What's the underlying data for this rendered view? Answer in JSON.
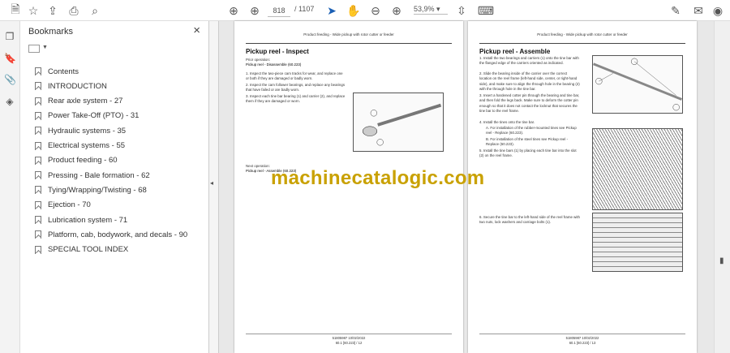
{
  "toolbar": {
    "page_current": "818",
    "page_total": "/ 1107",
    "zoom": "53,9%"
  },
  "sidebar": {
    "title": "Bookmarks",
    "close": "×",
    "items": [
      {
        "label": "Contents"
      },
      {
        "label": "INTRODUCTION"
      },
      {
        "label": "Rear axle system - 27"
      },
      {
        "label": "Power Take-Off (PTO) - 31"
      },
      {
        "label": "Hydraulic systems - 35"
      },
      {
        "label": "Electrical systems - 55"
      },
      {
        "label": "Product feeding - 60"
      },
      {
        "label": "Pressing - Bale formation - 62"
      },
      {
        "label": "Tying/Wrapping/Twisting - 68"
      },
      {
        "label": "Ejection - 70"
      },
      {
        "label": "Lubrication system - 71"
      },
      {
        "label": "Platform, cab, bodywork, and decals - 90"
      },
      {
        "label": "SPECIAL TOOL INDEX"
      }
    ]
  },
  "left_page": {
    "header": "Product feeding - Wide pickup with rotor cutter or feeder",
    "title": "Pickup reel - Inspect",
    "prior_label": "Prior operation:",
    "prior_link": "Pickup reel - Disassemble (60.223)",
    "steps": [
      "1.  Inspect the two-piece cam tracks for wear, and replace one or both if they are damaged or badly worn.",
      "2.  Inspect the cam follower bearings, and replace any bearings that have failed or are badly worn.",
      "3.  Inspect each tine bar bearing (1) and carrier (2), and replace them if they are damaged or worn."
    ],
    "next_label": "Next operation:",
    "next_link": "Pickup reel - Assemble (60.223)",
    "footer_1": "51805987 10/02/2022",
    "footer_2": "60.1 [60.223] / 12"
  },
  "right_page": {
    "header": "Product feeding - Wide pickup with rotor cutter or feeder",
    "title": "Pickup reel - Assemble",
    "steps": [
      "1.  Install the two bearings and carriers (1) onto the tine bar with the flanged edge of the carriers oriented as indicated.",
      "2.  Slide the bearing inside of the carrier over the correct location on the reel frame (left-hand side, center, or right-hand side), and make sure to align the through hole in the bearing (2) with the through hole in the tine bar.",
      "3.  Insert a hardened cotter pin through the bearing and tine bar, and then fold the legs back. Make sure to deform the cotter pin enough so that it does not contact the locknut that secures the tine bar to the reel frame.",
      "4.  Install the tines onto the tine bar.",
      "A.  For installation of the rubber-mounted tines see Pickup reel - Replace (60.223).",
      "B.  For installation of the steel tines see Pickup reel - Replace (60.223).",
      "5.  Install the tine bars (1) by placing each tine bar into the slot (2) on the reel frame."
    ],
    "step6": "6.  Secure the tine bar to the left-hand side of the reel frame with two nuts, lock washers and carriage bolts (1).",
    "footer_1": "51805987 10/02/2022",
    "footer_2": "60.1 [60.223] / 13"
  },
  "watermark": "machinecatalogic.com"
}
